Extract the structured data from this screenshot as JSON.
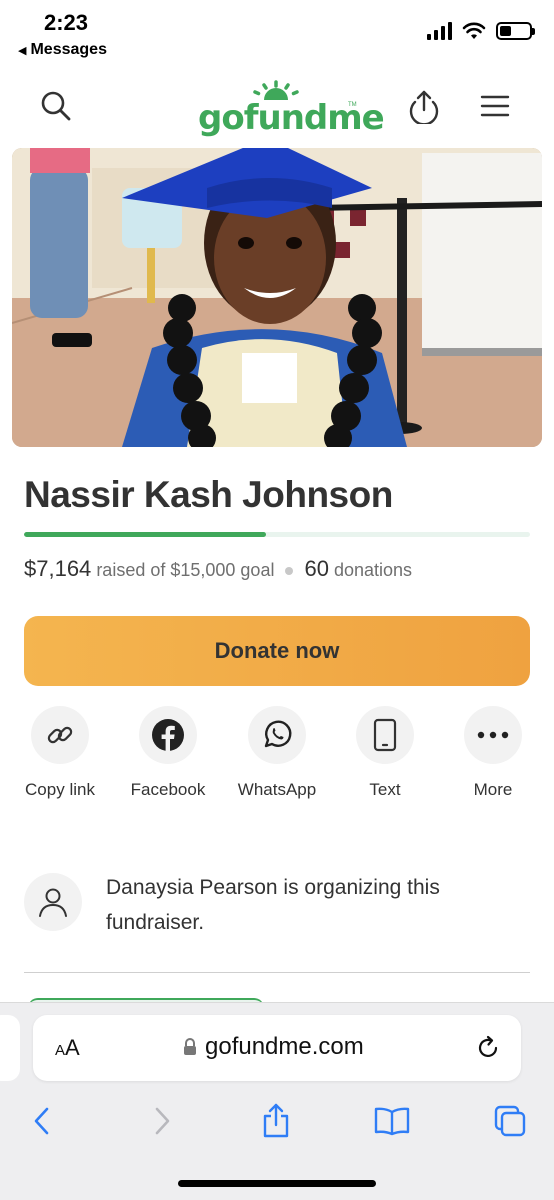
{
  "status_bar": {
    "time": "2:23",
    "back_label": "Messages"
  },
  "header": {
    "logo_text": "gofundme",
    "logo_tm": "TM",
    "brand_color": "#3fa85a"
  },
  "campaign": {
    "title": "Nassir Kash Johnson",
    "progress_fraction": 0.4776,
    "raised": "$7,164",
    "raised_suffix": "raised of $15,000 goal",
    "donation_count": "60",
    "donations_label": "donations",
    "donate_label": "Donate now"
  },
  "share": [
    {
      "label": "Copy link",
      "icon": "link-icon"
    },
    {
      "label": "Facebook",
      "icon": "facebook-icon"
    },
    {
      "label": "WhatsApp",
      "icon": "whatsapp-icon"
    },
    {
      "label": "Text",
      "icon": "phone-icon"
    },
    {
      "label": "More",
      "icon": "more-icon"
    }
  ],
  "organizer": {
    "text": "Danaysia Pearson is organizing this fundraiser."
  },
  "browser": {
    "aa_label_small": "A",
    "aa_label_big": "A",
    "url": "gofundme.com"
  },
  "colors": {
    "accent_green": "#3fa85a",
    "donate_orange": "#f0a544",
    "ios_blue": "#2f7df6"
  }
}
